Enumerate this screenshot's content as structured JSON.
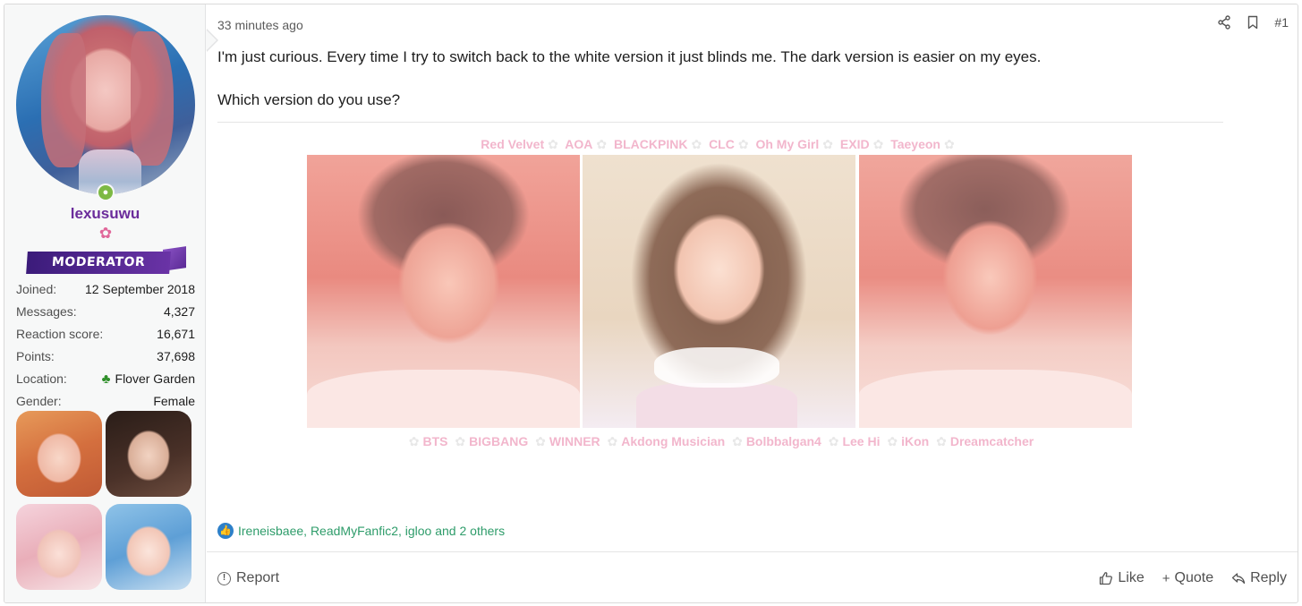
{
  "user": {
    "username": "lexusuwu",
    "flair_icon": "cherry-blossom-icon",
    "badge": "MODERATOR",
    "stats": [
      {
        "label": "Joined:",
        "value": "12 September 2018"
      },
      {
        "label": "Messages:",
        "value": "4,327"
      },
      {
        "label": "Reaction score:",
        "value": "16,671"
      },
      {
        "label": "Points:",
        "value": "37,698"
      },
      {
        "label": "Location:",
        "value": "Flover Garden",
        "icon": "clover-icon"
      },
      {
        "label": "Gender:",
        "value": "Female"
      }
    ]
  },
  "post": {
    "time": "33 minutes ago",
    "number": "#1",
    "paragraphs": [
      "I'm just curious. Every time I try to switch back to the white version it just blinds me. The dark version is easier on my eyes.",
      "Which version do you use?"
    ]
  },
  "signature": {
    "top_groups": [
      "Red Velvet",
      "AOA",
      "BLACKPINK",
      "CLC",
      "Oh My Girl",
      "EXID",
      "Taeyeon"
    ],
    "bottom_groups": [
      "BTS",
      "BIGBANG",
      "WINNER",
      "Akdong Musician",
      "Bolbbalgan4",
      "Lee Hi",
      "iKon",
      "Dreamcatcher"
    ]
  },
  "reactions": {
    "text": "Ireneisbaee, ReadMyFanfic2, igloo and 2 others"
  },
  "footer": {
    "report": "Report",
    "like": "Like",
    "quote": "Quote",
    "reply": "Reply"
  },
  "colors": {
    "username": "#6b2c9b",
    "reactions": "#2e9c6a",
    "signature": "#f2b6cc"
  }
}
